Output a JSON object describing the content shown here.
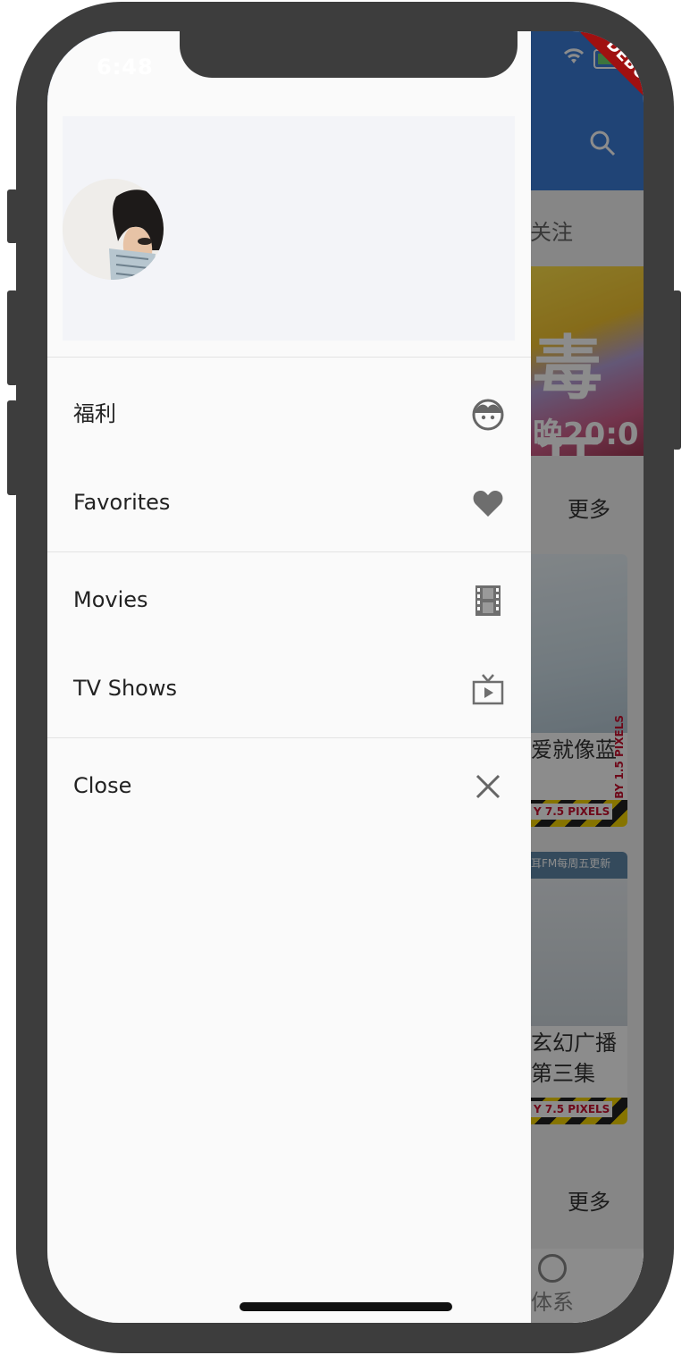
{
  "status": {
    "time": "6:48"
  },
  "debug_banner": "DEBUG",
  "background_app": {
    "tab_follow": "关注",
    "banner_big": "毒开",
    "banner_small": "晚20:0",
    "more_1": "更多",
    "card1": {
      "title": "爱就像蓝",
      "stripe": "Y 7.5 PIXELS",
      "side": "BY 1.5 PIXELS"
    },
    "card2": {
      "top": "耳FM每周五更新",
      "title": "玄幻广播 第三集",
      "stripe": "Y 7.5 PIXELS"
    },
    "more_2": "更多",
    "nav_label": "体系"
  },
  "drawer": {
    "items": [
      {
        "label": "福利",
        "icon": "face-icon"
      },
      {
        "label": "Favorites",
        "icon": "heart-icon"
      },
      {
        "label": "Movies",
        "icon": "film-icon"
      },
      {
        "label": "TV Shows",
        "icon": "tv-icon"
      },
      {
        "label": "Close",
        "icon": "close-icon"
      }
    ]
  },
  "colors": {
    "appbar": "#3b7dd8",
    "drawer_bg": "#fafafa",
    "header_bg": "#f3f4f8",
    "icon": "#666666"
  }
}
